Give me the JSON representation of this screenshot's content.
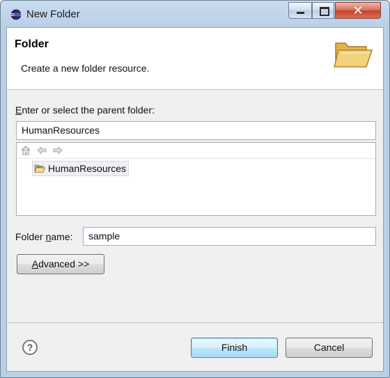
{
  "window": {
    "title": "New Folder",
    "icons": {
      "app": "eclipse-icon",
      "minimize": "minimize-icon",
      "maximize": "maximize-icon",
      "close": "close-icon"
    },
    "close_glyph": "✕"
  },
  "header": {
    "title": "Folder",
    "description": "Create a new folder resource.",
    "icon": "open-folder-icon"
  },
  "parent": {
    "label_mnemonic": "E",
    "label_rest": "nter or select the parent folder:",
    "value": "HumanResources",
    "toolbar_icons": [
      "home-icon",
      "back-arrow-icon",
      "forward-arrow-icon"
    ],
    "tree_items": [
      {
        "label": "HumanResources",
        "icon": "project-folder-icon",
        "selected": true
      }
    ]
  },
  "folder_name": {
    "label_prefix": "Folder ",
    "label_mnemonic": "n",
    "label_suffix": "ame:",
    "value": "sample"
  },
  "buttons": {
    "advanced_mnemonic": "A",
    "advanced_rest": "dvanced >>",
    "help_glyph": "?",
    "finish": "Finish",
    "cancel": "Cancel"
  },
  "colors": {
    "titlebar": "#b9cfe6",
    "dialog_bg": "#f0f0f0",
    "header_bg": "#ffffff",
    "close_button": "#c44128",
    "default_button_border": "#3c7fb1"
  }
}
